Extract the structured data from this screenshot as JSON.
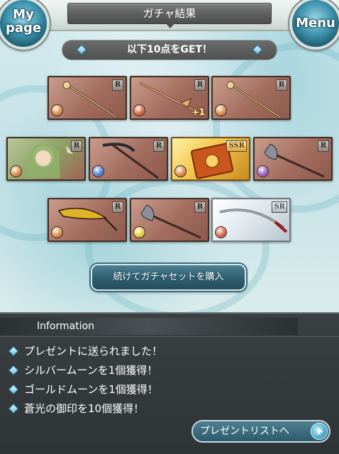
{
  "header": {
    "title": "ガチャ結果",
    "mypage_label": "My\npage",
    "menu_label": "Menu"
  },
  "banner": {
    "text": "以下10点をGET！"
  },
  "items": [
    {
      "rarity": "R",
      "element": "fire",
      "element_color": "#d7792a",
      "kind": "staff",
      "label": ""
    },
    {
      "rarity": "R",
      "element": "fire",
      "element_color": "#d04a28",
      "kind": "spear",
      "label": "+1"
    },
    {
      "rarity": "R",
      "element": "fire",
      "element_color": "#d7792a",
      "kind": "staff",
      "label": ""
    },
    {
      "rarity": "R",
      "element": "fire",
      "element_color": "#d7792a",
      "kind": "character",
      "label": ""
    },
    {
      "rarity": "R",
      "element": "water",
      "element_color": "#2f6fd6",
      "kind": "scythe",
      "label": ""
    },
    {
      "rarity": "SSR",
      "element": "fire",
      "element_color": "#d7792a",
      "kind": "tome",
      "label": ""
    },
    {
      "rarity": "R",
      "element": "dark",
      "element_color": "#8a45c6",
      "kind": "axe",
      "label": ""
    },
    {
      "rarity": "R",
      "element": "fire",
      "element_color": "#d7792a",
      "kind": "blade",
      "label": ""
    },
    {
      "rarity": "R",
      "element": "light",
      "element_color": "#e8c21c",
      "kind": "axe",
      "label": ""
    },
    {
      "rarity": "SR",
      "element": "fire",
      "element_color": "#d04a28",
      "kind": "katana",
      "label": ""
    }
  ],
  "buy_button": {
    "label": "続けてガチャセットを購入"
  },
  "info": {
    "title": "Information",
    "rows": [
      "プレゼントに送られました！",
      "シルバームーンを1個獲得！",
      "ゴールドムーンを1個獲得！",
      "蒼光の御印を10個獲得！"
    ],
    "present_button": "プレゼントリストへ"
  }
}
